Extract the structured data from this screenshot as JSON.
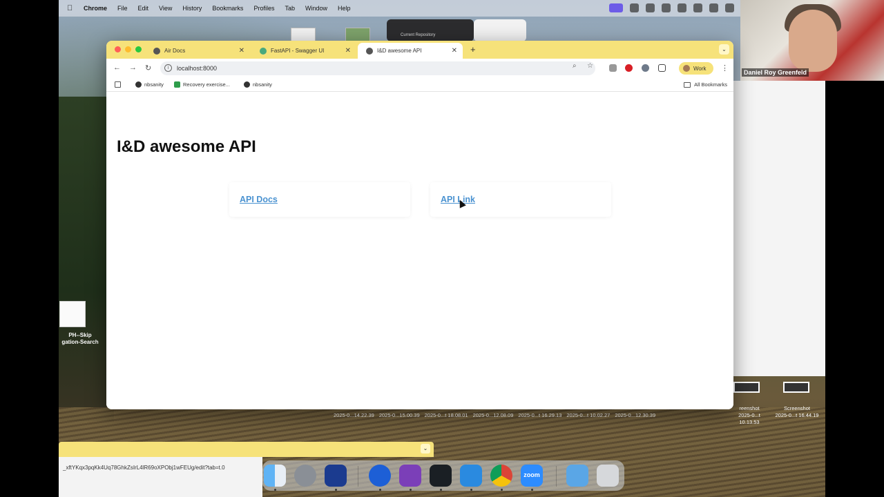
{
  "menubar": {
    "app_name": "Chrome",
    "items": [
      "File",
      "Edit",
      "View",
      "History",
      "Bookmarks",
      "Profiles",
      "Tab",
      "Window",
      "Help"
    ]
  },
  "video": {
    "name": "Daniel Roy Greenfeld"
  },
  "background_window": {
    "label": "Current Repository"
  },
  "desktop_icon": {
    "label_line1": "PH--Skip",
    "label_line2": "gation-Search"
  },
  "screenshots": {
    "items": [
      {
        "label_line1": "reenshot",
        "label_line2": "2025-0...t 10.13.53"
      },
      {
        "label_line1": "Screenshot",
        "label_line2": "2025-0...t 16.44.19"
      }
    ],
    "dates": [
      "2025-0...14.22.39",
      "2025-0...15.00.39",
      "2025-0...t 18.08.01",
      "2025-0...12.08.09",
      "2025-0...t 16.29.13",
      "2025-0...t 10.02.27",
      "2025-0...12.30.39"
    ]
  },
  "browser": {
    "tabs": [
      {
        "label": "Air Docs",
        "active": false
      },
      {
        "label": "FastAPI - Swagger UI",
        "active": false
      },
      {
        "label": "I&D awesome API",
        "active": true
      }
    ],
    "url": "localhost:8000",
    "profile": "Work",
    "bookmarks": [
      "nbsanity",
      "Recovery exercise...",
      "nbsanity"
    ],
    "all_bookmarks": "All Bookmarks"
  },
  "page": {
    "title": "I&D awesome API",
    "links": [
      {
        "label": "API Docs"
      },
      {
        "label": "API Link"
      }
    ]
  },
  "status_url": "_xftYKqx3pqKk4Uq78GhkZsIrL4lR69oXPObj1wFEUg/edit?tab=t.0",
  "dock": {
    "apps": [
      "finder-icon",
      "system-settings-icon",
      "xcode-icon",
      "1password-icon",
      "github-desktop-icon",
      "activity-monitor-icon",
      "vscode-icon",
      "chrome-icon",
      "zoom-icon",
      "preview-icon",
      "trash-icon"
    ],
    "zoom_label": "zoom"
  },
  "colors": {
    "chrome_theme": "#f6e27a",
    "link": "#4b93d1"
  }
}
